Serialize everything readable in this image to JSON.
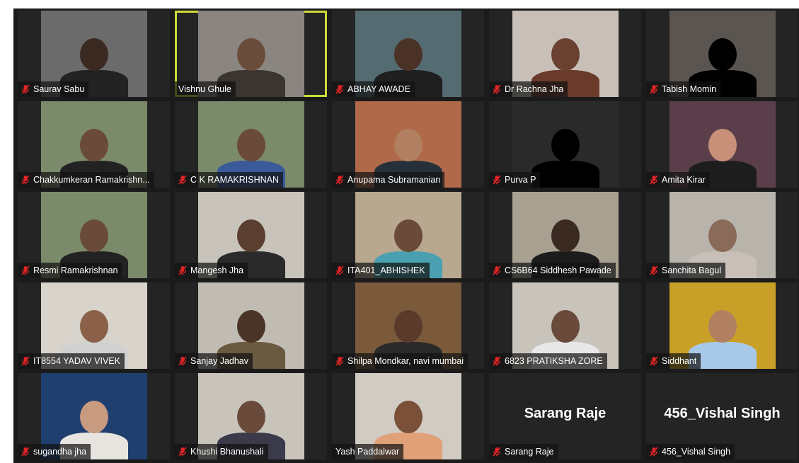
{
  "meeting": {
    "view": "gallery",
    "active_speaker": "Vishnu Ghule",
    "mute_icon": "microphone-muted-icon"
  },
  "participants": [
    {
      "name": "Saurav Sabu",
      "muted": true,
      "video": true,
      "bg": "#6b6b6b",
      "skin": "#3a2a22",
      "shirt": "#222222"
    },
    {
      "name": "Vishnu Ghule",
      "muted": false,
      "video": true,
      "active": true,
      "bg": "#8a8580",
      "skin": "#6a4c3a",
      "shirt": "#3a3530"
    },
    {
      "name": "ABHAY AWADE",
      "muted": true,
      "video": true,
      "bg": "#556b72",
      "skin": "#4a3326",
      "shirt": "#1f1f1f"
    },
    {
      "name": "Dr Rachna Jha",
      "muted": true,
      "video": true,
      "bg": "#c8c0b8",
      "skin": "#6a4030",
      "shirt": "#6a3a2a"
    },
    {
      "name": "Tabish Momin",
      "muted": true,
      "video": true,
      "bg": "#5a5550",
      "skin": "#000000",
      "shirt": "#000000"
    },
    {
      "name": "Chakkumkeran Ramakrishn...",
      "muted": true,
      "video": true,
      "bg": "#7a8a6a",
      "skin": "#6a4a3a",
      "shirt": "#222222"
    },
    {
      "name": "C K RAMAKRISHNAN",
      "muted": true,
      "video": true,
      "bg": "#7a8a6a",
      "skin": "#6a4a3a",
      "shirt": "#3a5a9a"
    },
    {
      "name": "Anupama Subramanian",
      "muted": true,
      "video": true,
      "bg": "#b06a4a",
      "skin": "#b08060",
      "shirt": "#26303a"
    },
    {
      "name": "Purva P",
      "muted": true,
      "video": true,
      "bg": "#2a2a2a",
      "skin": "#000000",
      "shirt": "#000000"
    },
    {
      "name": "Amita Kirar",
      "muted": true,
      "video": true,
      "bg": "#5a3f4a",
      "skin": "#c89078",
      "shirt": "#1d1d1d"
    },
    {
      "name": "Resmi Ramakrishnan",
      "muted": true,
      "video": true,
      "bg": "#7a8a6a",
      "skin": "#6a4a3a",
      "shirt": "#222222"
    },
    {
      "name": "Mangesh Jha",
      "muted": true,
      "video": true,
      "bg": "#c8c4bc",
      "skin": "#5a3f30",
      "shirt": "#2a2a2a"
    },
    {
      "name": "ITA401_ABHISHEK",
      "muted": true,
      "video": true,
      "bg": "#b8a890",
      "skin": "#6a4a38",
      "shirt": "#4aa0b0"
    },
    {
      "name": "CS6B64 Siddhesh Pawade",
      "muted": true,
      "video": true,
      "bg": "#a8a090",
      "skin": "#3a2a22",
      "shirt": "#1c1c1c"
    },
    {
      "name": "Sanchita Bagul",
      "muted": true,
      "video": true,
      "bg": "#b8b4ac",
      "skin": "#8a6a58",
      "shirt": "#c8c0b8"
    },
    {
      "name": "IT8554 YADAV VIVEK",
      "muted": true,
      "video": true,
      "bg": "#d8d4cc",
      "skin": "#8a6048",
      "shirt": "#d0d0d0"
    },
    {
      "name": "Sanjay Jadhav",
      "muted": true,
      "video": true,
      "bg": "#c0bcb4",
      "skin": "#4a3428",
      "shirt": "#6a5a40"
    },
    {
      "name": "Shilpa Mondkar, navi mumbai",
      "muted": true,
      "video": true,
      "bg": "#7a5a3a",
      "skin": "#5a3a2a",
      "shirt": "#2a2a2a"
    },
    {
      "name": "6823 PRATIKSHA ZORE",
      "muted": true,
      "video": true,
      "bg": "#c8c4bc",
      "skin": "#6a4a3a",
      "shirt": "#e8e8e8"
    },
    {
      "name": "Siddhant",
      "muted": true,
      "video": true,
      "bg": "#c8a028",
      "skin": "#b08060",
      "shirt": "#a8c8e8"
    },
    {
      "name": "sugandha jha",
      "muted": true,
      "video": true,
      "bg": "#1f3f6f",
      "skin": "#c89a80",
      "shirt": "#e8e4e0"
    },
    {
      "name": "Khushi Bhanushali",
      "muted": true,
      "video": true,
      "bg": "#c8c4bc",
      "skin": "#6a4a3a",
      "shirt": "#3a3a4a"
    },
    {
      "name": "Yash Paddalwar",
      "muted": false,
      "video": true,
      "bg": "#d0ccc4",
      "skin": "#7a5038",
      "shirt": "#e0a078"
    },
    {
      "name": "Sarang Raje",
      "muted": true,
      "video": false,
      "display_name": "Sarang Raje"
    },
    {
      "name": "456_Vishal Singh",
      "muted": true,
      "video": false,
      "display_name": "456_Vishal Singh"
    }
  ]
}
